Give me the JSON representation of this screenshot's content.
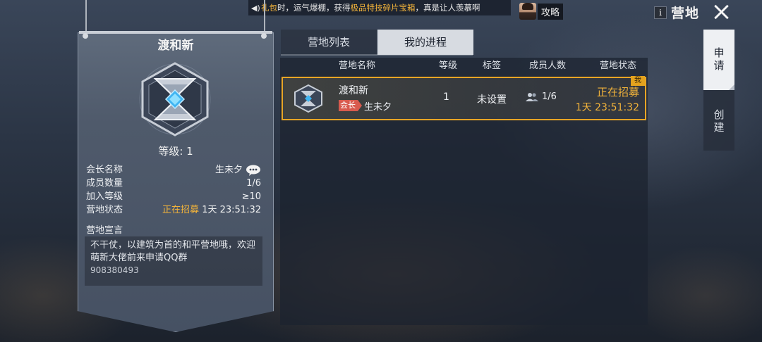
{
  "ticker": {
    "seg1": "礼包",
    "seg2": "时，运气爆棚，获得",
    "seg3": "极品特技碎片宝箱",
    "seg4": "，真是让人羡慕啊"
  },
  "header": {
    "guide_label": "攻略",
    "info_label": "i",
    "title": "营地"
  },
  "camp_card": {
    "name": "渡和新",
    "level_label": "等级: 1",
    "rows": [
      {
        "key": "会长名称",
        "value": "生未夕"
      },
      {
        "key": "成员数量",
        "value": "1/6"
      },
      {
        "key": "加入等级",
        "value": "≥10"
      },
      {
        "key": "营地状态",
        "value": "正在招募",
        "timer": "1天 23:51:32"
      }
    ],
    "declaration_title": "营地宣言",
    "declaration_text": "不干仗，以建筑为首的和平营地哦，欢迎萌新大佬前来申请QQ群",
    "declaration_number": "908380493"
  },
  "tabs": {
    "list": "营地列表",
    "progress": "我的进程"
  },
  "table": {
    "headers": {
      "name": "营地名称",
      "level": "等级",
      "tag": "标签",
      "members": "成员人数",
      "status": "营地状态"
    },
    "row": {
      "badge": "我",
      "name": "渡和新",
      "leader_tag": "会长",
      "leader": "生未夕",
      "level": "1",
      "tag": "未设置",
      "members": "1/6",
      "status": "正在招募",
      "timer": "1天 23:51:32"
    }
  },
  "side_tabs": {
    "apply": "申请",
    "create": "创建"
  },
  "colors": {
    "accent_gold": "#f2b33a",
    "leader_red": "#d85a4e",
    "selected_border": "#e8a525"
  }
}
